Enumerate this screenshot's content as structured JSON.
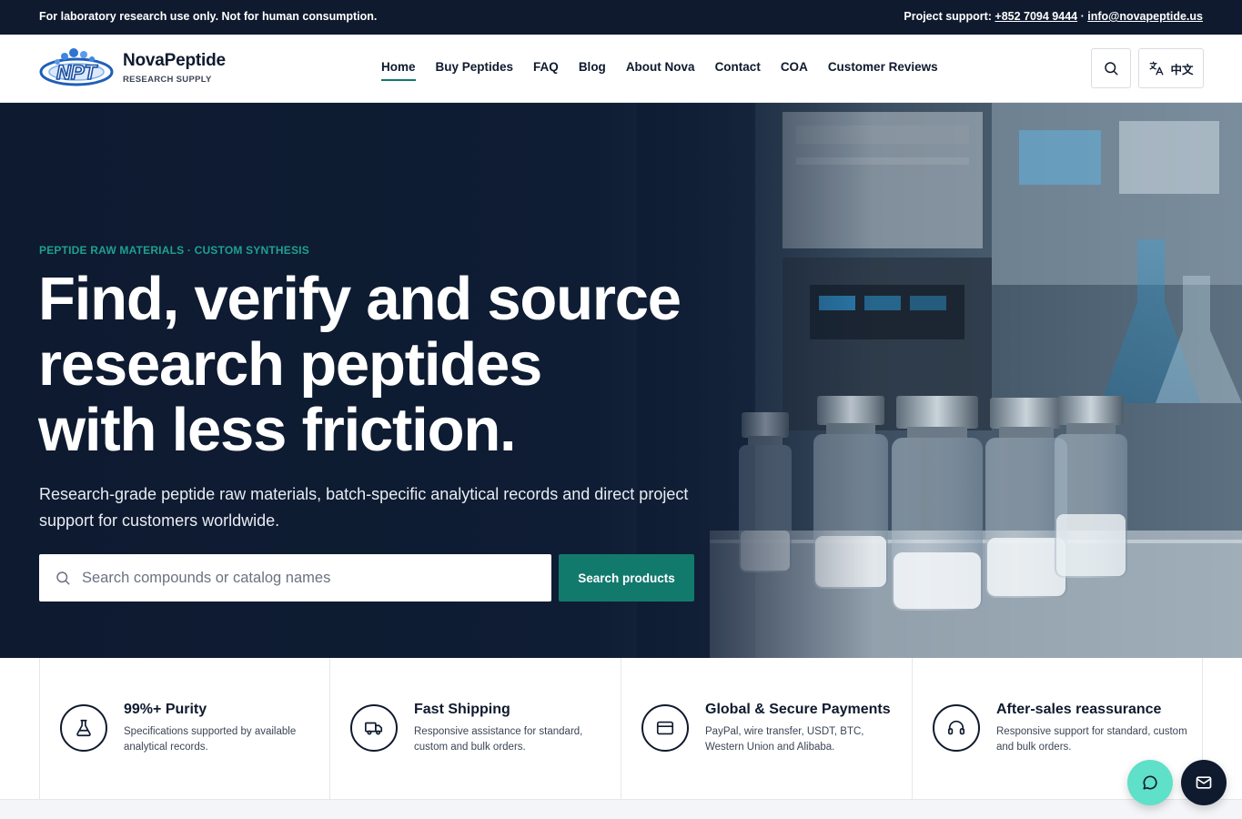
{
  "topbar": {
    "notice": "For laboratory research use only. Not for human consumption.",
    "support_label": "Project support: ",
    "phone": "+852 7094 9444",
    "separator": " · ",
    "email": "info@novapeptide.us"
  },
  "brand": {
    "logo_text": "NPT",
    "name": "NovaPeptide",
    "tagline": "RESEARCH SUPPLY"
  },
  "nav": {
    "items": [
      {
        "label": "Home",
        "active": true
      },
      {
        "label": "Buy Peptides"
      },
      {
        "label": "FAQ"
      },
      {
        "label": "Blog"
      },
      {
        "label": "About Nova"
      },
      {
        "label": "Contact"
      },
      {
        "label": "COA"
      },
      {
        "label": "Customer Reviews"
      }
    ],
    "language_label": "中文",
    "search_icon": "search-icon",
    "language_icon": "translate-icon"
  },
  "hero": {
    "eyebrow": "PEPTIDE RAW MATERIALS · CUSTOM SYNTHESIS",
    "headline_line1": "Find, verify and source",
    "headline_line2": "research peptides",
    "headline_line3": "with less friction.",
    "subcopy": "Research-grade peptide raw materials, batch-specific analytical records and direct project support for customers worldwide.",
    "search_placeholder": "Search compounds or catalog names",
    "search_value": "",
    "search_button": "Search products"
  },
  "features": [
    {
      "icon": "flask-icon",
      "title": "99%+ Purity",
      "description": "Specifications supported by available analytical records."
    },
    {
      "icon": "truck-icon",
      "title": "Fast Shipping",
      "description": "Responsive assistance for standard, custom and bulk orders."
    },
    {
      "icon": "credit-card-icon",
      "title": "Global & Secure Payments",
      "description": "PayPal, wire transfer, USDT, BTC, Western Union and Alibaba."
    },
    {
      "icon": "headset-icon",
      "title": "After-sales reassurance",
      "description": "Responsive support for standard, custom and bulk orders."
    }
  ],
  "floating": {
    "chat_icon": "chat-icon",
    "mail_icon": "mail-icon"
  },
  "colors": {
    "navy": "#0f1a2e",
    "teal": "#127a6d",
    "teal_light": "#1ea08e",
    "chat_fab": "#5fe0c8"
  }
}
